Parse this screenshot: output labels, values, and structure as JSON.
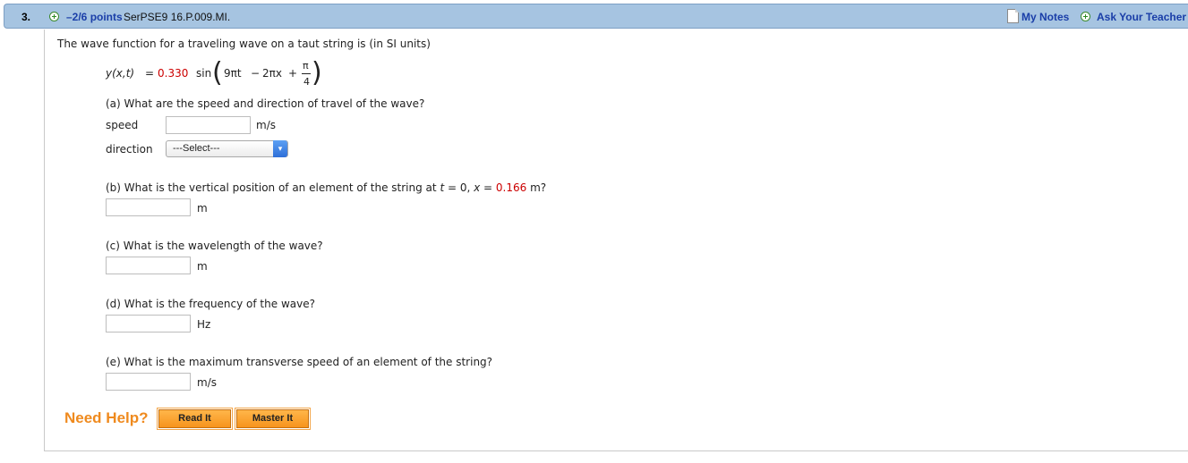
{
  "header": {
    "question_number": "3.",
    "points": "–2/6 points",
    "reference": "SerPSE9 16.P.009.MI.",
    "my_notes": "My Notes",
    "ask_teacher": "Ask Your Teacher"
  },
  "problem": {
    "intro": "The wave function for a traveling wave on a taut string is (in SI units)",
    "equation": {
      "lhs": "y(x,t)",
      "equals": "=",
      "amplitude": "0.330",
      "func": "sin",
      "term1": "9πt",
      "minus": "−",
      "term2": "2πx",
      "plus": "+",
      "frac_num": "π",
      "frac_den": "4"
    },
    "part_a": {
      "question": "(a) What are the speed and direction of travel of the wave?",
      "speed_label": "speed",
      "speed_value": "",
      "speed_unit": "m/s",
      "direction_label": "direction",
      "direction_selected": "---Select---"
    },
    "part_b": {
      "question_prefix": "(b) What is the vertical position of an element of the string at ",
      "t_var": "t",
      "t_expr": " = 0, ",
      "x_var": "x",
      "x_eq": " = ",
      "x_value": "0.166",
      "unit_suffix": " m?",
      "answer_value": "",
      "answer_unit": "m"
    },
    "part_c": {
      "question": "(c) What is the wavelength of the wave?",
      "answer_value": "",
      "answer_unit": "m"
    },
    "part_d": {
      "question": "(d) What is the frequency of the wave?",
      "answer_value": "",
      "answer_unit": "Hz"
    },
    "part_e": {
      "question": "(e) What is the maximum transverse speed of an element of the string?",
      "answer_value": "",
      "answer_unit": "m/s"
    }
  },
  "help": {
    "label": "Need Help?",
    "read_it": "Read It",
    "master_it": "Master It"
  },
  "colors": {
    "header_bg": "#a6c4e1",
    "link_blue": "#1a3ea8",
    "highlight_red": "#cc0000",
    "help_orange": "#ef8a1e"
  },
  "icons": [
    "plus-circle-icon",
    "notes-icon",
    "dropdown-arrow-icon"
  ]
}
